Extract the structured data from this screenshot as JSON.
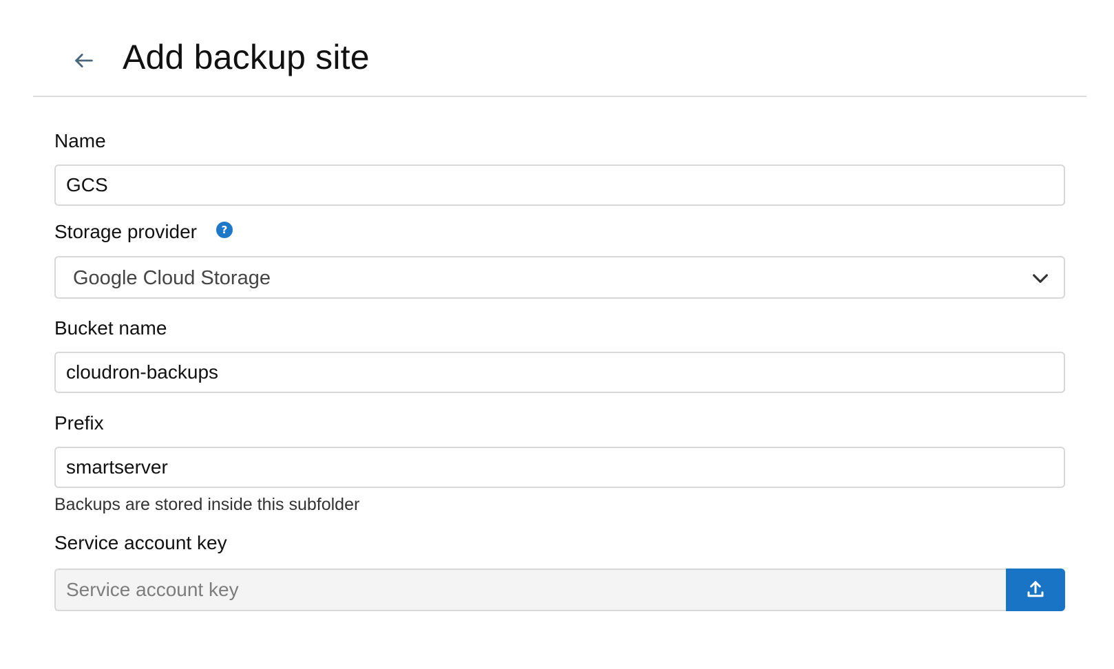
{
  "header": {
    "title": "Add backup site",
    "back_icon": "arrow-left-icon"
  },
  "form": {
    "name": {
      "label": "Name",
      "value": "GCS"
    },
    "storage_provider": {
      "label": "Storage provider",
      "help_icon": "question-circle-icon",
      "help_glyph": "?",
      "selected": "Google Cloud Storage",
      "chevron_icon": "chevron-down-icon"
    },
    "bucket_name": {
      "label": "Bucket name",
      "value": "cloudron-backups"
    },
    "prefix": {
      "label": "Prefix",
      "value": "smartserver",
      "helper": "Backups are stored inside this subfolder"
    },
    "service_account_key": {
      "label": "Service account key",
      "value": "",
      "placeholder": "Service account key",
      "upload_icon": "upload-icon"
    }
  },
  "colors": {
    "accent": "#1a74c6",
    "border": "#d8d8d8",
    "input_disabled_bg": "#f4f4f4"
  }
}
